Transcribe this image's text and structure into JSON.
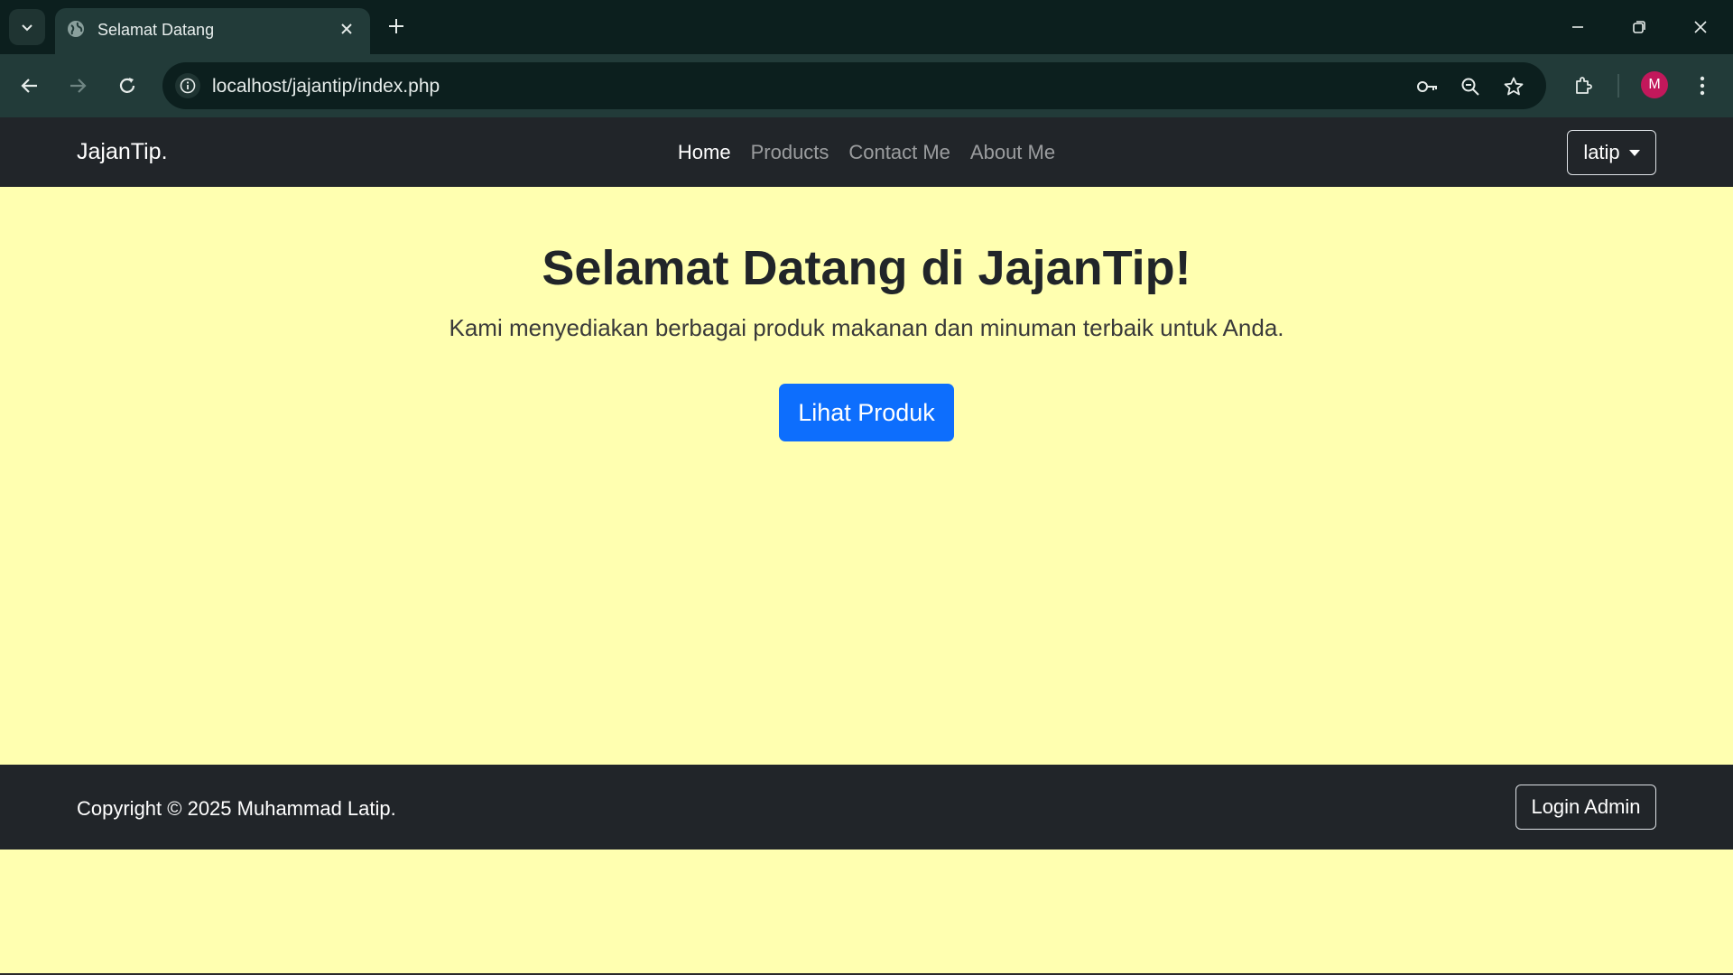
{
  "browser": {
    "tab_title": "Selamat Datang",
    "url": "localhost/jajantip/index.php",
    "profile_initial": "M"
  },
  "navbar": {
    "brand": "JajanTip.",
    "links": [
      {
        "label": "Home",
        "active": true
      },
      {
        "label": "Products",
        "active": false
      },
      {
        "label": "Contact Me",
        "active": false
      },
      {
        "label": "About Me",
        "active": false
      }
    ],
    "user": "latip"
  },
  "hero": {
    "title": "Selamat Datang di JajanTip!",
    "subtitle": "Kami menyediakan berbagai produk makanan dan minuman terbaik untuk Anda.",
    "button": "Lihat Produk"
  },
  "footer": {
    "copyright": "Copyright © 2025 Muhammad Latip.",
    "login_button": "Login Admin"
  },
  "colors": {
    "page_background": "#ffffb0",
    "navbar_background": "#212529",
    "primary": "#0d6efd",
    "browser_frame": "#0c1f1e",
    "browser_toolbar": "#223b39",
    "avatar": "#c2185b"
  },
  "icons": [
    "tab-search-icon",
    "globe-icon",
    "close-icon",
    "plus-icon",
    "minimize-icon",
    "restore-icon",
    "window-close-icon",
    "back-icon",
    "forward-icon",
    "reload-icon",
    "info-icon",
    "key-icon",
    "zoom-icon",
    "star-icon",
    "extensions-icon",
    "menu-icon"
  ]
}
